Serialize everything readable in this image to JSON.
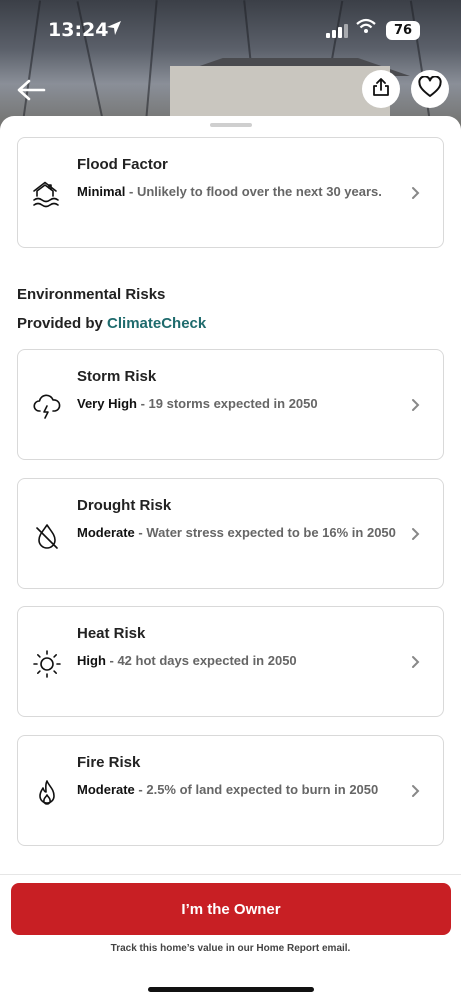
{
  "status_bar": {
    "time": "13:24",
    "location_icon": "location-arrow-icon",
    "battery": "76"
  },
  "header": {
    "back_icon": "back-arrow-icon",
    "share_icon": "share-icon",
    "favorite_icon": "heart-icon"
  },
  "flood": {
    "title": "Flood Factor",
    "level": "Minimal",
    "separator": " - ",
    "description": "Unlikely to flood over the next 30 years.",
    "icon": "flood-house-icon"
  },
  "environmental": {
    "heading": "Environmental Risks",
    "provided_by": "Provided by",
    "provider": "ClimateCheck",
    "provider_color": "#1f6b6d"
  },
  "risks": [
    {
      "title": "Storm Risk",
      "level": "Very High",
      "separator": " - ",
      "description": "19 storms expected in 2050",
      "icon": "storm-cloud-icon"
    },
    {
      "title": "Drought Risk",
      "level": "Moderate",
      "separator": " - ",
      "description": "Water stress expected to be 16% in 2050",
      "icon": "drought-drop-icon"
    },
    {
      "title": "Heat Risk",
      "level": "High",
      "separator": " - ",
      "description": "42 hot days expected in 2050",
      "icon": "sun-icon"
    },
    {
      "title": "Fire Risk",
      "level": "Moderate",
      "separator": " - ",
      "description": "2.5% of land expected to burn in 2050",
      "icon": "flame-icon"
    }
  ],
  "footer": {
    "button_label": "I’m the Owner",
    "button_color": "#c81f24",
    "note": "Track this home’s value in our Home Report email."
  }
}
